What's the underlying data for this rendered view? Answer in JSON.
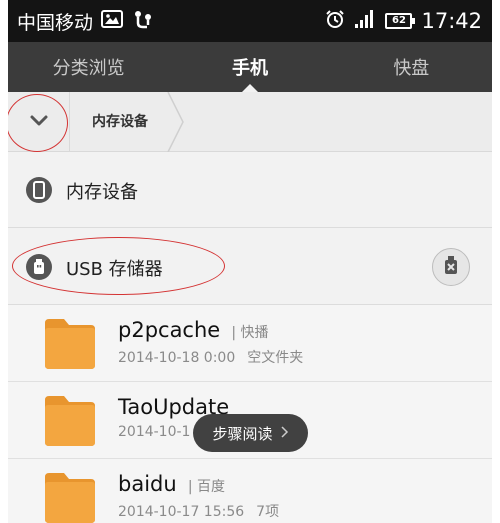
{
  "status_bar": {
    "carrier": "中国移动",
    "battery": "62",
    "time": "17:42"
  },
  "tabs": [
    {
      "label": "分类浏览"
    },
    {
      "label": "手机"
    },
    {
      "label": "快盘"
    }
  ],
  "breadcrumb": {
    "current": "内存设备"
  },
  "storage": {
    "internal_label": "内存设备",
    "usb_label": "USB 存储器"
  },
  "files": [
    {
      "name": "p2pcache",
      "tag": "快播",
      "date": "2014-10-18 0:00",
      "info": "空文件夹"
    },
    {
      "name": "TaoUpdate",
      "tag": "",
      "date": "2014-10-1",
      "info": ""
    },
    {
      "name": "baidu",
      "tag": "百度",
      "date": "2014-10-17 15:56",
      "info": "7项"
    }
  ],
  "toast": {
    "label": "步骤阅读"
  },
  "colors": {
    "annotation_red": "#d43434",
    "folder_orange": "#f0a23a",
    "tabbar_bg": "#3b3b3b"
  },
  "icons": [
    "picture-icon",
    "usb-debug-icon",
    "alarm-icon",
    "signal-icon",
    "battery-icon",
    "chevron-down-icon",
    "phone-storage-icon",
    "usb-storage-icon",
    "eject-icon",
    "folder-icon",
    "chevron-right-icon"
  ]
}
